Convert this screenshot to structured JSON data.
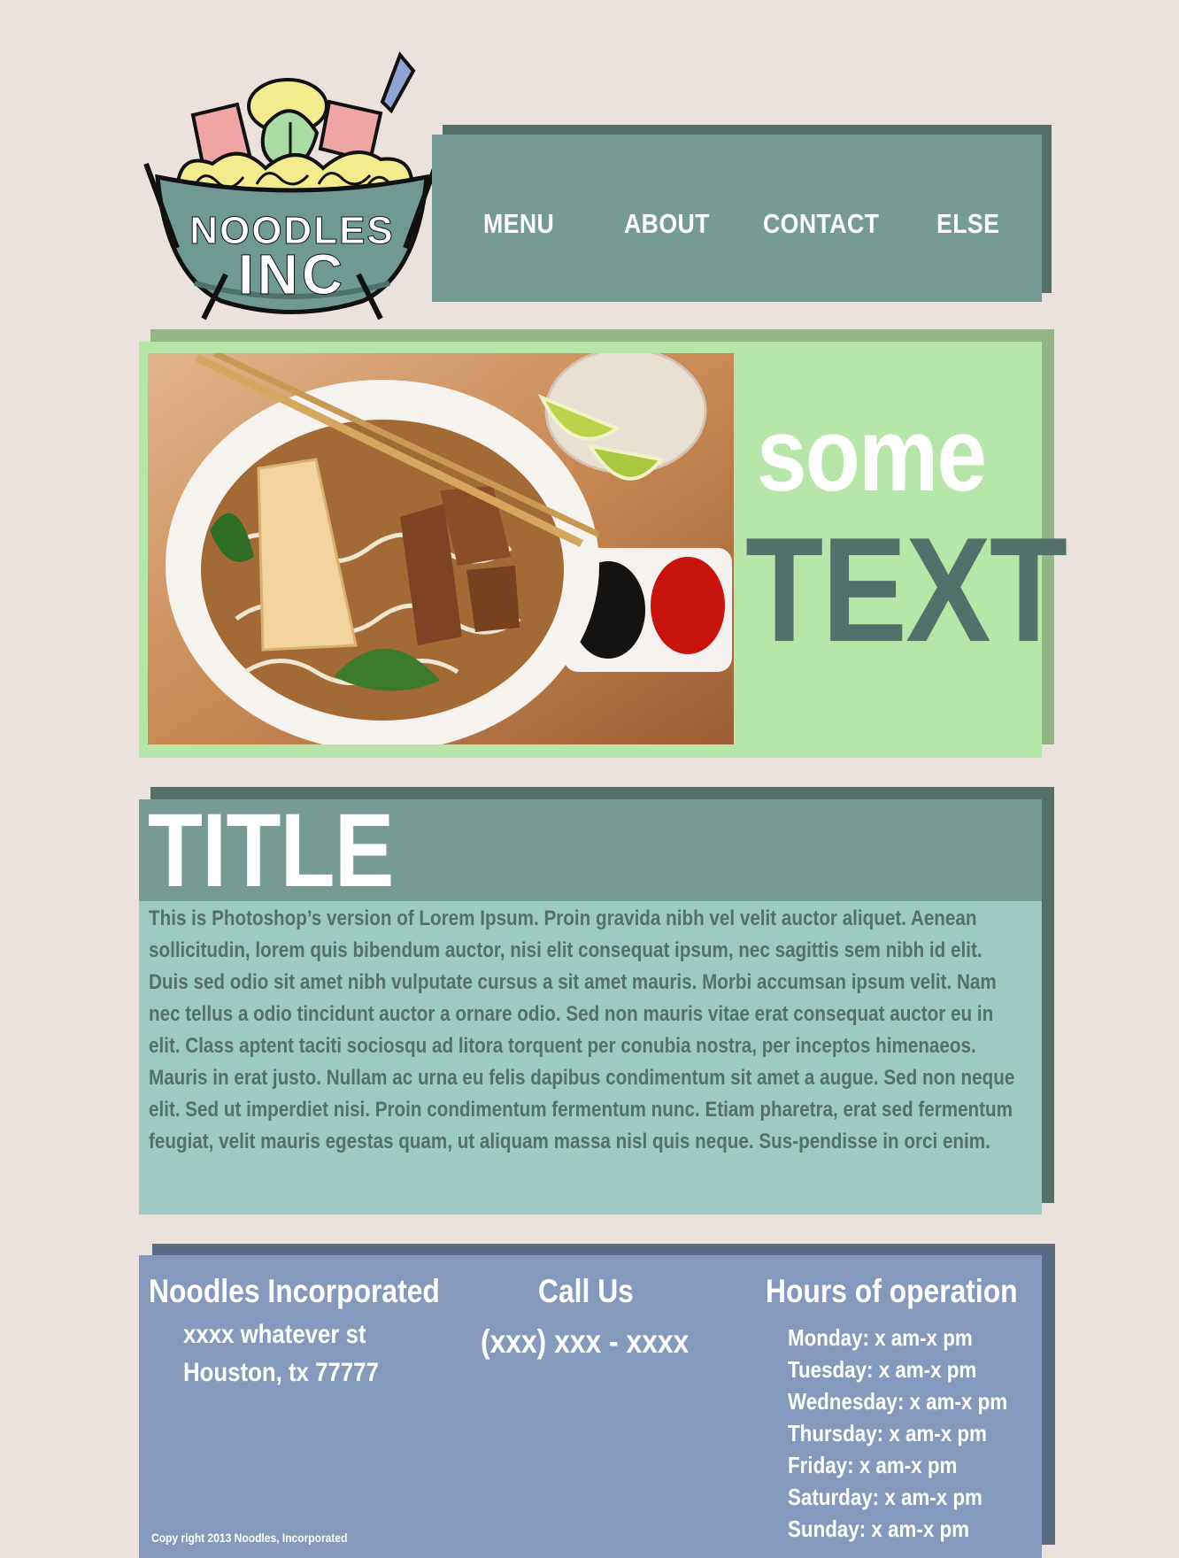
{
  "logo": {
    "line1": "NOODLES",
    "line2": "INC"
  },
  "nav": {
    "items": [
      {
        "label": "MENU"
      },
      {
        "label": "ABOUT"
      },
      {
        "label": "CONTACT"
      },
      {
        "label": "ELSE"
      }
    ]
  },
  "hero": {
    "line1": "some",
    "line2": "TEXT"
  },
  "content": {
    "title": "TITLE",
    "body": "This is Photoshop’s version  of Lorem Ipsum. Proin gravida nibh vel velit auctor aliquet. Aenean sollicitudin, lorem quis bibendum auctor, nisi elit consequat ipsum, nec sagittis sem nibh id elit. Duis sed odio sit amet nibh vulputate cursus a sit amet mauris. Morbi accumsan ipsum velit. Nam nec tellus a odio tincidunt auctor a ornare odio. Sed non  mauris vitae erat consequat auctor eu in elit. Class aptent taciti sociosqu ad litora torquent per conubia nostra, per inceptos himenaeos. Mauris in erat justo. Nullam ac urna eu felis dapibus condimentum sit amet a augue. Sed non neque elit. Sed ut imperdiet nisi. Proin condimentum fermentum nunc. Etiam pharetra, erat sed fermentum feugiat, velit mauris egestas quam, ut aliquam massa nisl quis neque. Sus-pendisse in orci enim."
  },
  "footer": {
    "company": "Noodles Incorporated",
    "address1": "xxxx whatever st",
    "address2": "Houston, tx 77777",
    "call_title": "Call Us",
    "phone": "(xxx) xxx - xxxx",
    "hours_title": "Hours of operation",
    "hours": [
      "Monday: x am-x pm",
      "Tuesday: x am-x pm",
      "Wednesday: x am-x pm",
      "Thursday: x am-x pm",
      "Friday: x am-x pm",
      "Saturday: x am-x pm",
      "Sunday: x am-x pm"
    ],
    "copyright": "Copy right 2013 Noodles, Incorporated"
  },
  "colors": {
    "background": "#ebe2dd",
    "nav": "#769b94",
    "nav_shadow": "#557068",
    "hero": "#b7e6a9",
    "hero_shadow": "#94b687",
    "content_body": "#9dcac3",
    "footer": "#8599bc",
    "footer_shadow": "#5c6b85"
  },
  "icons": [
    "noodle-bowl-logo",
    "noodle-soup-photo"
  ]
}
